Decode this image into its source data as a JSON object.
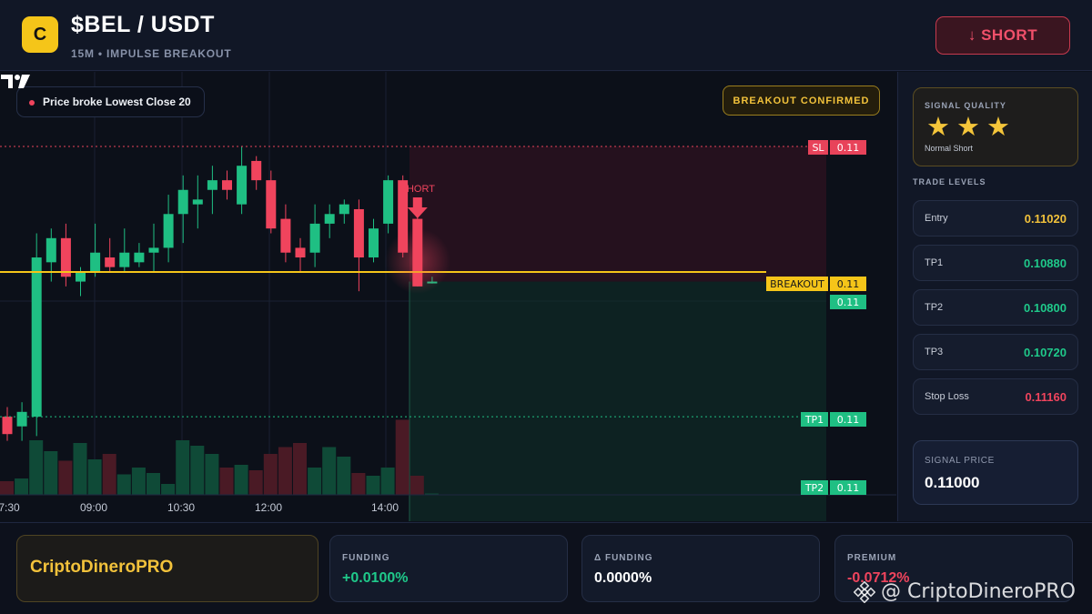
{
  "header": {
    "logo_letter": "C",
    "pair": "$BEL / USDT",
    "subtitle": "15M • IMPULSE BREAKOUT",
    "action_label": "↓ SHORT"
  },
  "chart": {
    "note": "Price broke Lowest Close 20",
    "confirmed_label": "BREAKOUT CONFIRMED",
    "short_label": "SHORT",
    "time_labels": [
      "7:30",
      "09:00",
      "10:30",
      "12:00",
      "14:00"
    ],
    "level_tags": {
      "sl": {
        "name": "SL",
        "value": "0.11"
      },
      "breakout": {
        "name": "BREAKOUT",
        "value": "0.11"
      },
      "entry": {
        "value": "0.11"
      },
      "tp1": {
        "name": "TP1",
        "value": "0.11"
      },
      "tp2": {
        "name": "TP2",
        "value": "0.11"
      }
    },
    "colors": {
      "up": "#1fbf83",
      "down": "#f0445d",
      "breakout": "#f5c519"
    }
  },
  "chart_data": {
    "type": "candlestick",
    "xlabel": "",
    "ylabel": "",
    "levels": {
      "sl": 0.1116,
      "breakout": 0.1103,
      "entry": 0.1102,
      "tp1": 0.1088,
      "tp2": 0.108
    },
    "candles": [
      {
        "o": 0.1088,
        "h": 0.1089,
        "l": 0.10855,
        "c": 0.10862
      },
      {
        "o": 0.1087,
        "h": 0.10895,
        "l": 0.10855,
        "c": 0.10885
      },
      {
        "o": 0.1088,
        "h": 0.1107,
        "l": 0.1086,
        "c": 0.11045
      },
      {
        "o": 0.1104,
        "h": 0.11075,
        "l": 0.1102,
        "c": 0.11065
      },
      {
        "o": 0.11065,
        "h": 0.1108,
        "l": 0.11015,
        "c": 0.11025
      },
      {
        "o": 0.1102,
        "h": 0.11035,
        "l": 0.11005,
        "c": 0.1103
      },
      {
        "o": 0.1103,
        "h": 0.1108,
        "l": 0.11025,
        "c": 0.1105
      },
      {
        "o": 0.11045,
        "h": 0.11065,
        "l": 0.1103,
        "c": 0.11035
      },
      {
        "o": 0.11035,
        "h": 0.11075,
        "l": 0.1103,
        "c": 0.1105
      },
      {
        "o": 0.1104,
        "h": 0.1106,
        "l": 0.11035,
        "c": 0.1105
      },
      {
        "o": 0.1105,
        "h": 0.1108,
        "l": 0.1103,
        "c": 0.11055
      },
      {
        "o": 0.11055,
        "h": 0.1111,
        "l": 0.1104,
        "c": 0.1109
      },
      {
        "o": 0.1109,
        "h": 0.1113,
        "l": 0.1106,
        "c": 0.11115
      },
      {
        "o": 0.111,
        "h": 0.1113,
        "l": 0.11075,
        "c": 0.11105
      },
      {
        "o": 0.11115,
        "h": 0.1114,
        "l": 0.1109,
        "c": 0.11125
      },
      {
        "o": 0.11125,
        "h": 0.11135,
        "l": 0.11105,
        "c": 0.11115
      },
      {
        "o": 0.111,
        "h": 0.1116,
        "l": 0.1109,
        "c": 0.1114
      },
      {
        "o": 0.11145,
        "h": 0.1115,
        "l": 0.11115,
        "c": 0.11125
      },
      {
        "o": 0.11125,
        "h": 0.11135,
        "l": 0.1107,
        "c": 0.11075
      },
      {
        "o": 0.11085,
        "h": 0.111,
        "l": 0.1104,
        "c": 0.1105
      },
      {
        "o": 0.11055,
        "h": 0.11065,
        "l": 0.1103,
        "c": 0.11045
      },
      {
        "o": 0.1105,
        "h": 0.111,
        "l": 0.11035,
        "c": 0.1108
      },
      {
        "o": 0.1108,
        "h": 0.111,
        "l": 0.11065,
        "c": 0.1109
      },
      {
        "o": 0.1109,
        "h": 0.11105,
        "l": 0.1108,
        "c": 0.111
      },
      {
        "o": 0.11095,
        "h": 0.11105,
        "l": 0.1101,
        "c": 0.11045
      },
      {
        "o": 0.11045,
        "h": 0.11085,
        "l": 0.1104,
        "c": 0.11075
      },
      {
        "o": 0.1108,
        "h": 0.1113,
        "l": 0.1107,
        "c": 0.11125
      },
      {
        "o": 0.11125,
        "h": 0.1113,
        "l": 0.11045,
        "c": 0.1105
      },
      {
        "o": 0.11085,
        "h": 0.1109,
        "l": 0.11015,
        "c": 0.11015
      },
      {
        "o": 0.1102,
        "h": 0.11025,
        "l": 0.11018,
        "c": 0.1102
      }
    ],
    "volume": [
      10,
      12,
      40,
      32,
      25,
      38,
      26,
      30,
      15,
      20,
      16,
      8,
      40,
      36,
      30,
      20,
      22,
      18,
      30,
      35,
      38,
      20,
      35,
      28,
      16,
      14,
      20,
      55,
      14,
      1
    ]
  },
  "panel": {
    "quality_label": "SIGNAL QUALITY",
    "stars": [
      "★",
      "★",
      "★"
    ],
    "quality_type": "Normal Short",
    "levels_title": "TRADE LEVELS",
    "levels": [
      {
        "label": "Entry",
        "value": "0.11020",
        "color": "#f2c23b"
      },
      {
        "label": "TP1",
        "value": "0.10880",
        "color": "#1fc98a"
      },
      {
        "label": "TP2",
        "value": "0.10800",
        "color": "#1fc98a"
      },
      {
        "label": "TP3",
        "value": "0.10720",
        "color": "#1fc98a"
      },
      {
        "label": "Stop Loss",
        "value": "0.11160",
        "color": "#f0445d"
      }
    ],
    "signal_price_label": "SIGNAL PRICE",
    "signal_price": "0.11000"
  },
  "footer": {
    "brand": "CriptoDineroPRO",
    "stats": [
      {
        "label": "FUNDING",
        "value": "+0.0100%",
        "color": "#1fc98a"
      },
      {
        "label": "Δ FUNDING",
        "value": "0.0000%",
        "color": "#ffffff"
      },
      {
        "label": "PREMIUM",
        "value": "-0.0712%",
        "color": "#f0445d"
      }
    ],
    "watermark": "@ CriptoDineroPRO"
  }
}
